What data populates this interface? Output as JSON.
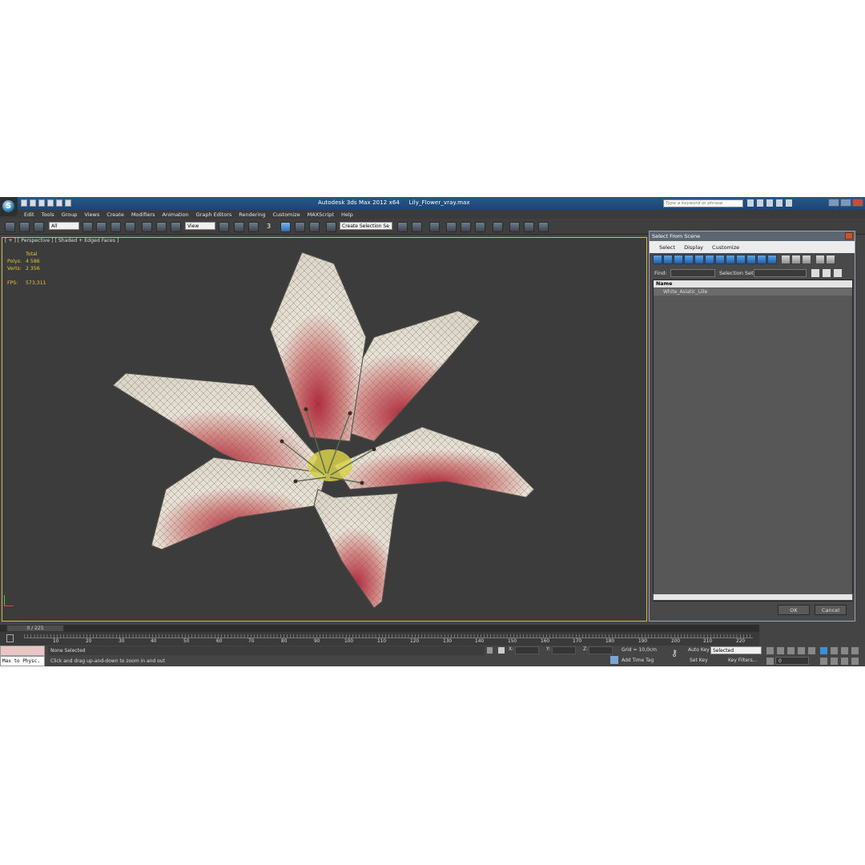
{
  "title_bar": {
    "app_title": "Autodesk 3ds Max  2012 x64",
    "file_name": "Lily_Flower_vray.max",
    "search_placeholder": "Type a keyword or phrase",
    "logo_letter": "S"
  },
  "menu": [
    "Edit",
    "Tools",
    "Group",
    "Views",
    "Create",
    "Modifiers",
    "Animation",
    "Graph Editors",
    "Rendering",
    "Customize",
    "MAXScript",
    "Help"
  ],
  "toolbar": {
    "filter_value": "All",
    "ref_coord_value": "View",
    "snap_label": "3",
    "selection_set_value": "Create Selection Se"
  },
  "viewport": {
    "label": "[ + ] [ Perspective ] [ Shaded + Edged Faces ]",
    "stats_header": "Total",
    "polys_label": "Polys:",
    "polys_value": "4 586",
    "verts_label": "Verts:",
    "verts_value": "2 356",
    "fps_label": "FPS:",
    "fps_value": "573,311"
  },
  "select_dialog": {
    "title": "Select From Scene",
    "menu": [
      "Select",
      "Display",
      "Customize"
    ],
    "find_label": "Find:",
    "selection_set_label": "Selection Set:",
    "column_name": "Name",
    "items": [
      "White_Asiatic_Lilie"
    ],
    "ok_label": "OK",
    "cancel_label": "Cancel"
  },
  "timeline": {
    "frame_indicator": "0 / 225",
    "tick_labels": [
      "10",
      "20",
      "30",
      "40",
      "50",
      "60",
      "70",
      "80",
      "90",
      "100",
      "110",
      "120",
      "130",
      "140",
      "150",
      "160",
      "170",
      "180",
      "190",
      "200",
      "210",
      "220"
    ]
  },
  "status": {
    "maxscript_text": "Max to Physc.",
    "selection_status": "None Selected",
    "prompt": "Click and drag up-and-down to zoom in and out",
    "x_label": "X:",
    "y_label": "Y:",
    "z_label": "Z:",
    "grid": "Grid = 10,0cm",
    "add_time_tag": "Add Time Tag",
    "auto_key": "Auto Key",
    "set_key": "Set Key",
    "key_filters": "Key Filters...",
    "selected_dropdown": "Selected",
    "current_frame": "0"
  }
}
